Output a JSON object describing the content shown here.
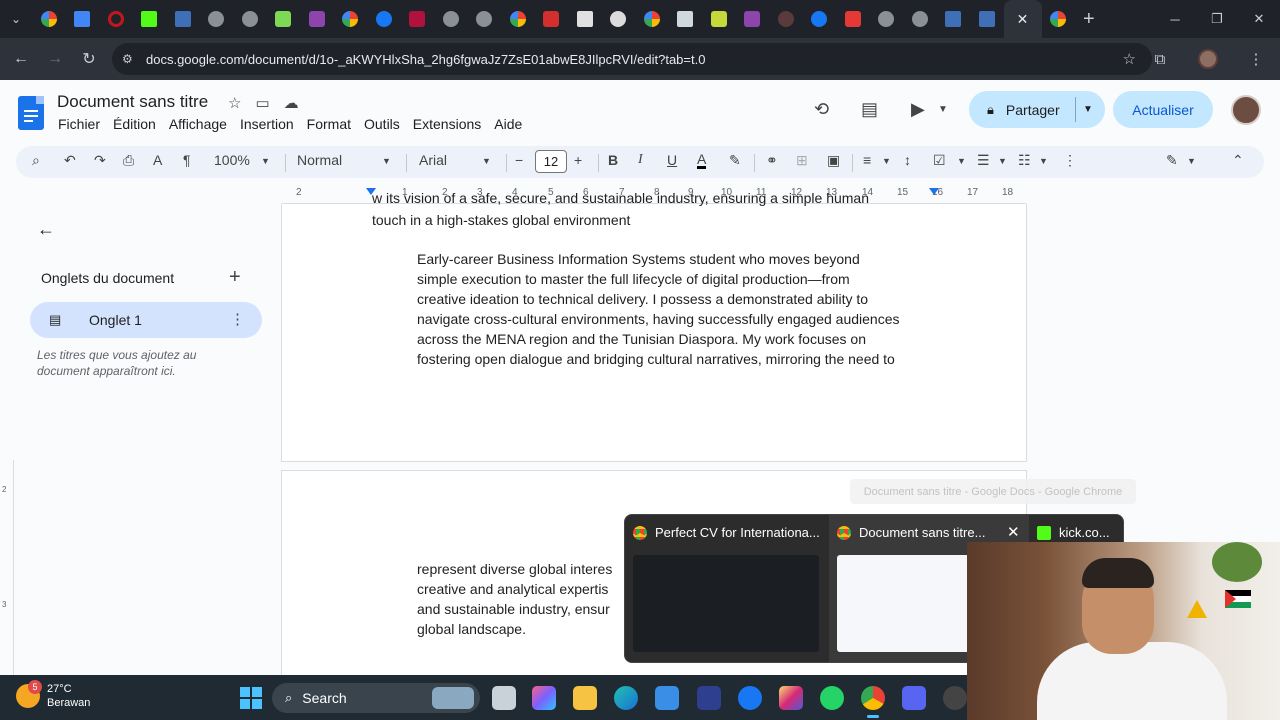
{
  "browser": {
    "tab_strip": {
      "new_tab_label": "+",
      "active_tab_close": "✕"
    },
    "url": "docs.google.com/document/d/1o-_aKWYHlxSha_2hg6fgwaJz7ZsE01abwE8JIlpcRVI/edit?tab=t.0"
  },
  "doc": {
    "title": "Document sans titre",
    "menu": [
      "Fichier",
      "Édition",
      "Affichage",
      "Insertion",
      "Format",
      "Outils",
      "Extensions",
      "Aide"
    ],
    "share_label": "Partager",
    "update_label": "Actualiser"
  },
  "toolbar": {
    "zoom": "100%",
    "style": "Normal",
    "font": "Arial",
    "font_size": "12"
  },
  "ruler": {
    "ticks": [
      "2",
      "1",
      "1",
      "2",
      "3",
      "4",
      "5",
      "6",
      "7",
      "8",
      "9",
      "10",
      "11",
      "12",
      "13",
      "14",
      "15",
      "16",
      "17",
      "18"
    ]
  },
  "sidebar": {
    "heading": "Onglets du document",
    "tab_label": "Onglet 1",
    "hint": "Les titres que vous ajoutez au document apparaîtront ici."
  },
  "page1": {
    "cut_top": "w its vision of a safe, secure, and sustainable industry, ensuring a simple human",
    "line_0": "touch in a high-stakes global environment",
    "para": [
      "Early-career Business Information Systems student who moves beyond",
      "simple execution to master the full lifecycle of digital production—from",
      "creative ideation to technical delivery. I possess a demonstrated ability to",
      "navigate cross-cultural environments, having successfully engaged audiences",
      "across the MENA region and the Tunisian Diaspora. My work focuses on",
      "fostering open dialogue and bridging cultural narratives, mirroring the need to"
    ]
  },
  "page2": {
    "lines": [
      "represent diverse global interes",
      "creative and analytical expertis",
      "and sustainable industry, ensur",
      "global landscape."
    ]
  },
  "hover": {
    "tooltip": "Document sans titre - Google Docs - Google Chrome",
    "items": [
      {
        "title": "Perfect CV for Internationa..."
      },
      {
        "title": "Document sans titre..."
      },
      {
        "title": "kick.co..."
      }
    ]
  },
  "taskbar": {
    "weather_temp": "27°C",
    "weather_place": "Berawan",
    "weather_badge": "5",
    "search_label": "Search"
  },
  "colors": {
    "docs_blue": "#1a73e8",
    "share_bg": "#c2e7ff",
    "tab_active_bg": "#d3e3fd",
    "taskbar_bg": "#1f2a33"
  }
}
